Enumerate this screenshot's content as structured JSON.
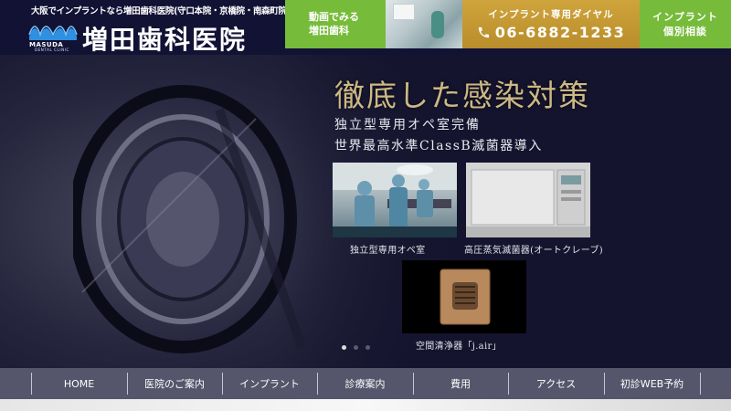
{
  "header": {
    "tagline": "大阪でインプラントなら増田歯科医院(守口本院・京橋院・南森町院)",
    "logo_en": "MASUDA",
    "logo_en_sub": "DENTAL CLINIC",
    "logo_jp": "増田歯科医院",
    "video_button": {
      "line1": "動画でみる",
      "line2": "増田歯科"
    },
    "phone_button": {
      "label": "インプラント専用ダイヤル",
      "number": "06-6882-1233",
      "icon": "phone-icon"
    },
    "consult_button": {
      "line1": "インプラント",
      "line2": "個別相談"
    },
    "colors": {
      "green": "#77bb3b",
      "gold": "#c49a33",
      "navy": "#121235"
    }
  },
  "hero": {
    "headline": "徹底した感染対策",
    "sub_line1": "独立型専用オペ室完備",
    "sub_line2": "世界最高水準ClassB滅菌器導入",
    "captions": {
      "operating_room": "独立型専用オペ室",
      "autoclave": "高圧蒸気滅菌器(オートクレーブ)",
      "air_purifier": "空間清浄器「j.air」"
    },
    "slide_count": 3,
    "active_slide": 1,
    "colors": {
      "headline": "#cdb885"
    }
  },
  "nav": {
    "items": [
      "HOME",
      "医院のご案内",
      "インプラント",
      "診療案内",
      "費用",
      "アクセス",
      "初診WEB予約"
    ]
  }
}
